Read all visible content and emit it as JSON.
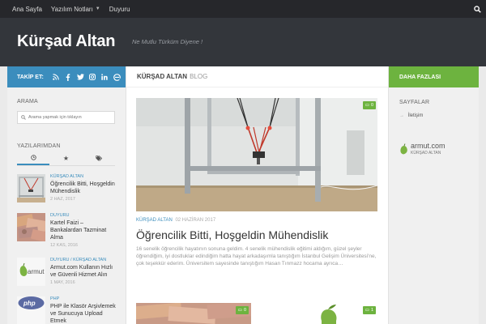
{
  "topnav": {
    "links": [
      "Ana Sayfa",
      "Yazılım Notları",
      "Duyuru"
    ]
  },
  "header": {
    "site_title": "Kürşad Altan",
    "tagline": "Ne Mutlu Türküm Diyene !"
  },
  "sidebar_left": {
    "follow_label": "TAKİP ET:",
    "search_title": "ARAMA",
    "search_placeholder": "Arama yapmak için tıklayın",
    "posts_title": "YAZILARIMDAN",
    "posts": [
      {
        "category": "KÜRŞAD ALTAN",
        "title": "Öğrencilik Bitti, Hoşgeldin Mühendislik",
        "date": "2 HAZ, 2017"
      },
      {
        "category": "DUYURU",
        "title": "Kartel Faizi – Bankalardan Tazminat Alma",
        "date": "12 KAS, 2016"
      },
      {
        "category": "DUYURU / KÜRŞAD ALTAN",
        "title": "Armut.com Kullanın Hızlı ve Güvenli Hizmet Alın",
        "date": "1 MAY, 2016"
      },
      {
        "category": "PHP",
        "title": "PHP ile Klasör Arşivlemek ve Sunucuya Upload Etmek",
        "date": ""
      }
    ]
  },
  "main": {
    "breadcrumb_author": "KÜRŞAD ALTAN",
    "breadcrumb_blog": "BLOG",
    "featured": {
      "comments": "0",
      "category": "KÜRŞAD ALTAN",
      "date": "02 HAZİRAN 2017",
      "title": "Öğrencilik Bitti, Hoşgeldin Mühendislik",
      "excerpt": "16 senelik öğrencilik hayatının sonuna geldim. 4 senelik mühendislik eğitimi aldığım, güzel şeyler öğrendiğim, iyi dostluklar edindiğim hatta hayat arkadaşımla tanıştığım İstanbul Gelişim Üniversitesi'ne, çok teşekkür ederim. Üniversitem sayesinde tanıştığım Hasan Tınmazz hocama ayrıca…"
    },
    "cards": [
      {
        "comments": "0"
      },
      {
        "comments": "1"
      }
    ]
  },
  "sidebar_right": {
    "more_label": "DAHA FAZLASI",
    "pages_title": "SAYFALAR",
    "pages_link": "İletişim",
    "logo_name": "armut.com",
    "logo_sub": "KÜRŞAD ALTAN"
  },
  "colors": {
    "topnav": "#26272b",
    "header": "#33363b",
    "follow": "#3b8dbd",
    "more": "#6db33f"
  }
}
